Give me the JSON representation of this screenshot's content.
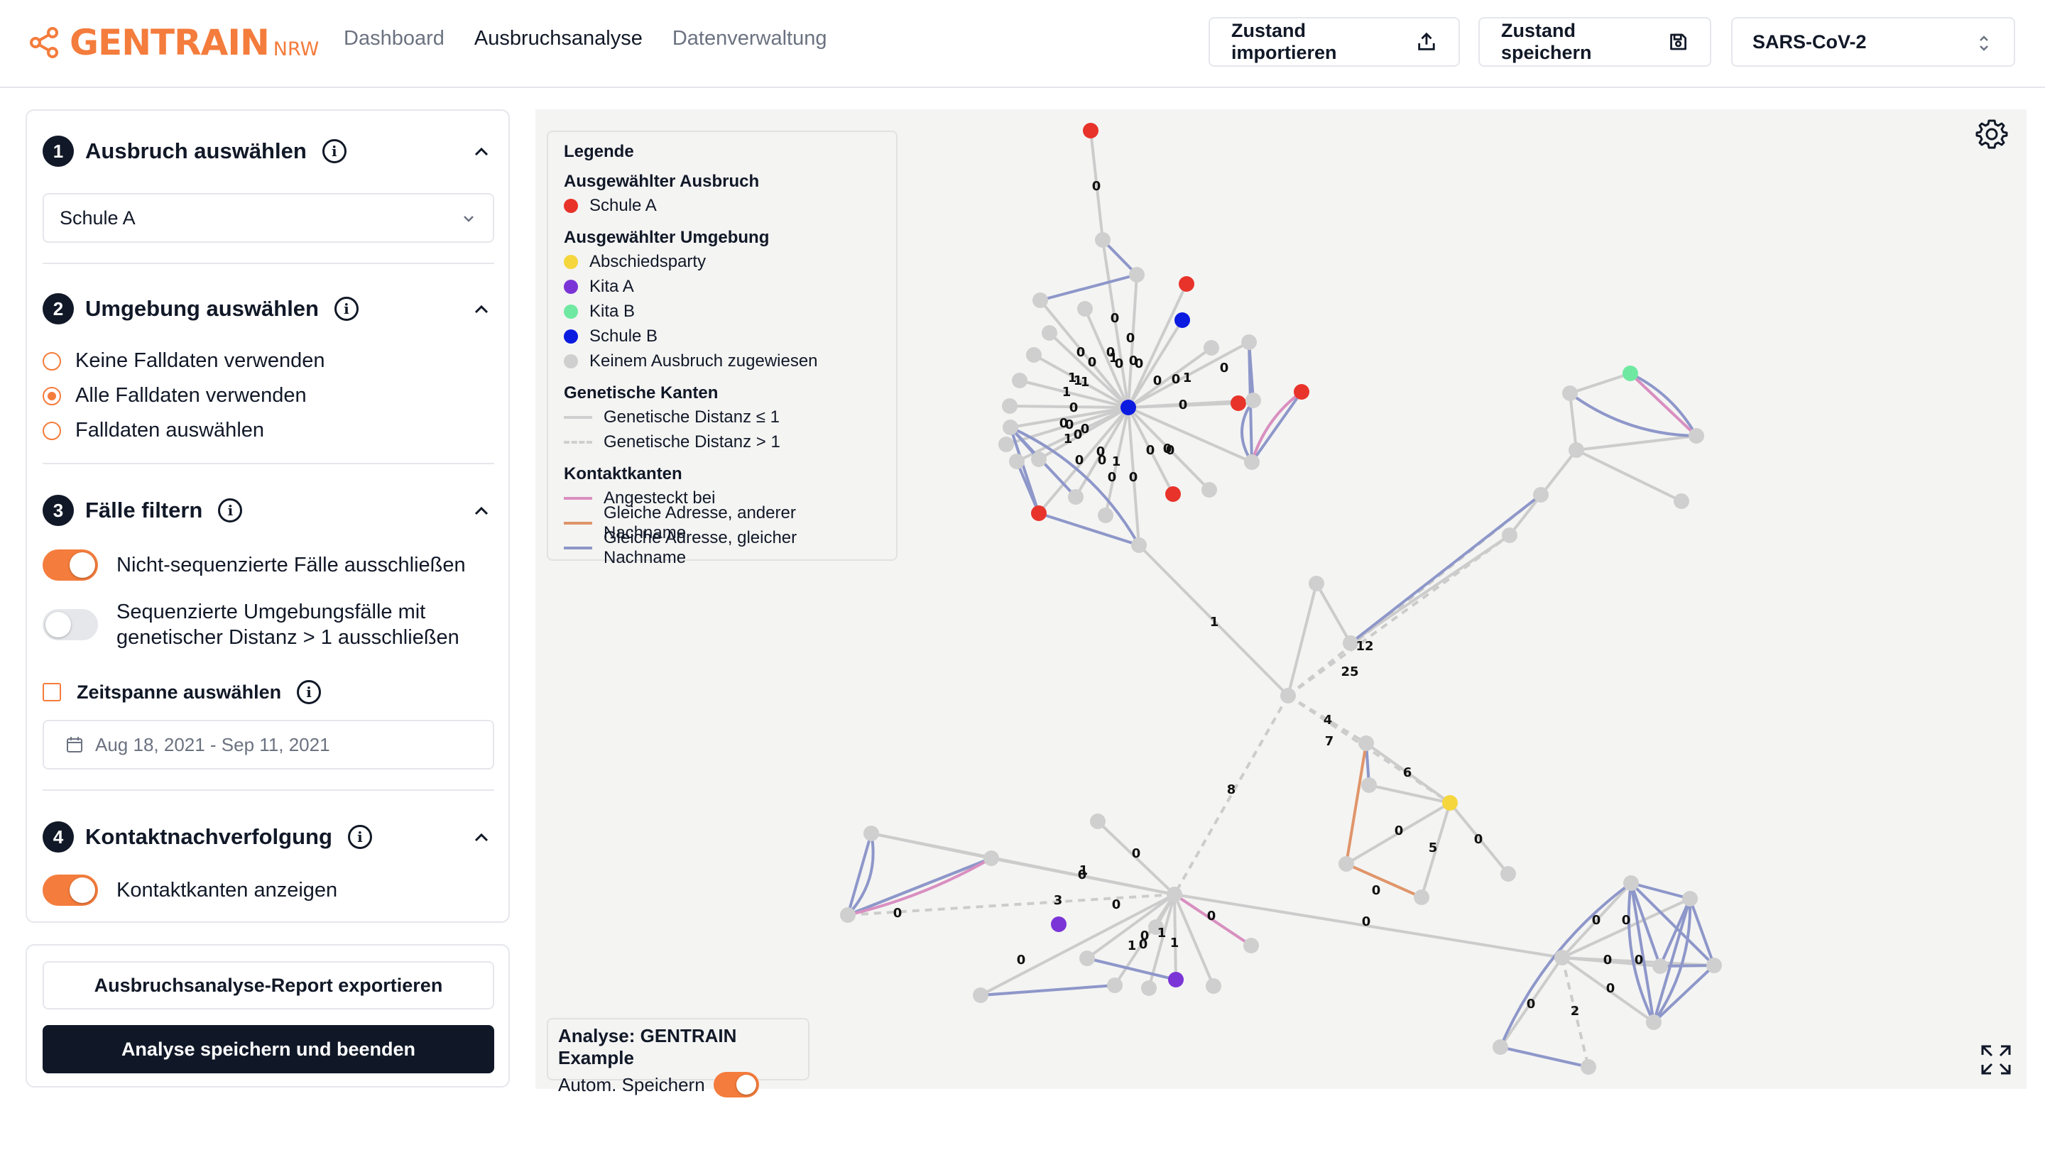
{
  "header": {
    "logo_main": "GENTRAIN",
    "logo_sub": "NRW",
    "nav": [
      "Dashboard",
      "Ausbruchsanalyse",
      "Datenverwaltung"
    ],
    "import_label": "Zustand importieren",
    "save_label": "Zustand speichern",
    "pathogen": "SARS-CoV-2",
    "brand_color": "#f47c3c"
  },
  "sidebar": {
    "s1": {
      "num": "1",
      "title": "Ausbruch auswählen",
      "selected": "Schule A"
    },
    "s2": {
      "num": "2",
      "title": "Umgebung auswählen",
      "options": [
        "Keine Falldaten verwenden",
        "Alle Falldaten verwenden",
        "Falldaten auswählen"
      ],
      "selected_index": 1
    },
    "s3": {
      "num": "3",
      "title": "Fälle filtern",
      "toggle1": "Nicht-sequenzierte Fälle ausschließen",
      "toggle2_line1": "Sequenzierte Umgebungsfälle mit",
      "toggle2_line2": "genetischer Distanz > 1 ausschließen",
      "checkbox": "Zeitspanne auswählen",
      "date_range": "Aug 18, 2021 - Sep 11, 2021"
    },
    "s4": {
      "num": "4",
      "title": "Kontaktnachverfolgung",
      "toggle": "Kontaktkanten anzeigen"
    },
    "export_button": "Ausbruchsanalyse-Report exportieren",
    "save_button": "Analyse speichern und beenden"
  },
  "legend": {
    "title": "Legende",
    "selected_outbreak_head": "Ausgewählter Ausbruch",
    "selected_outbreak": [
      {
        "label": "Schule A",
        "color": "#e8332a"
      }
    ],
    "environment_head": "Ausgewählter Umgebung",
    "environment": [
      {
        "label": "Abschiedsparty",
        "color": "#f5d63d"
      },
      {
        "label": "Kita A",
        "color": "#7b35d6"
      },
      {
        "label": "Kita B",
        "color": "#6fe9a1"
      },
      {
        "label": "Schule B",
        "color": "#0c1be0"
      },
      {
        "label": "Keinem Ausbruch zugewiesen",
        "color": "#cfcfcf"
      }
    ],
    "genetic_head": "Genetische Kanten",
    "genetic": [
      {
        "label": "Genetische Distanz ≤ 1",
        "style": "solid",
        "color": "#cfcfcf"
      },
      {
        "label": "Genetische Distanz > 1",
        "style": "dashed",
        "color": "#cfcfcf"
      }
    ],
    "contact_head": "Kontaktkanten",
    "contact": [
      {
        "label": "Angesteckt bei",
        "color": "#d98fc0"
      },
      {
        "label": "Gleiche Adresse, anderer Nachname",
        "color": "#e0956a"
      },
      {
        "label": "Gleiche Adresse, gleicher Nachname",
        "color": "#8e97c9"
      }
    ]
  },
  "analysis": {
    "title": "Analyse: GENTRAIN Example",
    "autosave": "Autom. Speichern"
  },
  "graph": {
    "colors": {
      "gray": "#cfcfcf",
      "red": "#e8332a",
      "blue": "#0c1be0",
      "purple": "#7b35d6",
      "green": "#6fe9a1",
      "yellow": "#f5d63d",
      "contact_blue": "#8e97c9",
      "contact_pink": "#d98fc0",
      "contact_orange": "#e0956a",
      "edge": "#cccccc"
    },
    "distance_labels": [
      "0",
      "0",
      "0",
      "0",
      "0",
      "0",
      "1",
      "0",
      "0",
      "0",
      "1",
      "1",
      "1",
      "0",
      "0",
      "1",
      "0",
      "0",
      "1",
      "0",
      "0",
      "1",
      "0",
      "0",
      "0",
      "0",
      "0",
      "0",
      "0",
      "1",
      "0",
      "0",
      "0",
      "0",
      "12",
      "25",
      "1",
      "4",
      "7",
      "6",
      "8",
      "0",
      "0",
      "5",
      "0",
      "0",
      "0",
      "3",
      "0",
      "1",
      "0",
      "1",
      "1",
      "0",
      "0",
      "0",
      "0",
      "0",
      "1",
      "0",
      "0",
      "0",
      "0",
      "0",
      "0",
      "2"
    ]
  }
}
